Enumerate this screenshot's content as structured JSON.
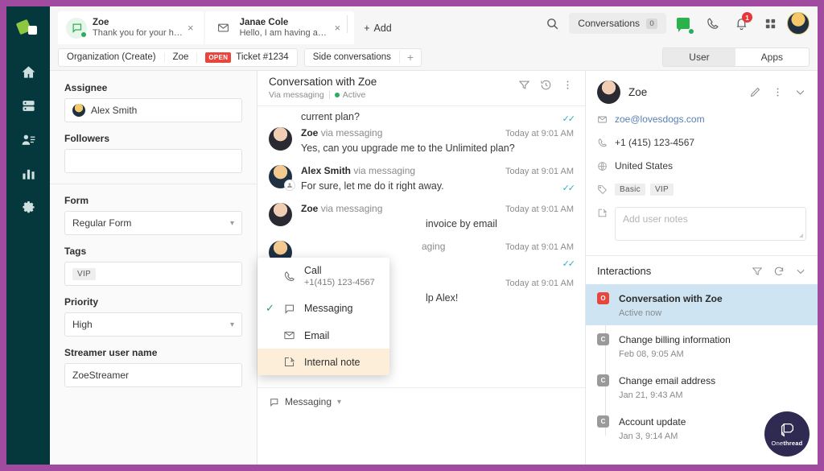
{
  "brand": {
    "accent_purple": "#a04ba0",
    "rail_bg": "#04383c",
    "logo_green": "#8dc63f"
  },
  "rail": {
    "logo_name": "app-logo",
    "items": [
      {
        "name": "home-icon",
        "label": "Home"
      },
      {
        "name": "inbox-icon",
        "label": "Inbox"
      },
      {
        "name": "contacts-icon",
        "label": "Contacts"
      },
      {
        "name": "analytics-icon",
        "label": "Analytics"
      },
      {
        "name": "gear-icon",
        "label": "Settings"
      }
    ]
  },
  "topbar": {
    "tabs": [
      {
        "title": "Zoe",
        "preview": "Thank you for your hel...",
        "icon": "chat-bubble-icon",
        "online": true,
        "close": "×"
      },
      {
        "title": "Janae Cole",
        "preview": "Hello, I am having an is...",
        "icon": "envelope-icon",
        "online": false,
        "close": "×"
      }
    ],
    "add_label": "Add",
    "add_plus": "+",
    "search_icon": "search-icon",
    "conversations_label": "Conversations",
    "conversations_count": "0",
    "chat_icon": "chat-icon",
    "phone_icon": "phone-icon",
    "bell_icon": "bell-icon",
    "bell_badge": "1",
    "apps_grid_icon": "grid-icon",
    "avatar": "user-avatar"
  },
  "breadcrumb": {
    "items": [
      {
        "label": "Organization (Create)"
      },
      {
        "label": "Zoe"
      },
      {
        "badge": "OPEN",
        "label": "Ticket #1234"
      }
    ],
    "side_conversations": "Side conversations",
    "plus": "+"
  },
  "segment": {
    "options": [
      "User",
      "Apps"
    ],
    "selected": "User"
  },
  "left_panel": {
    "fields": [
      {
        "label": "Assignee",
        "value": "Alex Smith",
        "type": "avatar-text"
      },
      {
        "label": "Followers",
        "value": "",
        "type": "text"
      },
      {
        "label": "Form",
        "value": "Regular Form",
        "type": "select"
      },
      {
        "label": "Tags",
        "value": "VIP",
        "type": "chip"
      },
      {
        "label": "Priority",
        "value": "High",
        "type": "select"
      },
      {
        "label": "Streamer user name",
        "value": "ZoeStreamer",
        "type": "text"
      }
    ]
  },
  "conversation": {
    "title": "Conversation with Zoe",
    "via": "Via messaging",
    "status": "Active",
    "actions": [
      "filter-icon",
      "history-icon",
      "more-vertical-icon"
    ],
    "continued_text": "current plan?",
    "messages": [
      {
        "author": "Zoe",
        "via": "via messaging",
        "time": "Today at 9:01 AM",
        "text": "Yes, can you upgrade me to the Unlimited plan?",
        "avatar": "zoe",
        "ticks": false,
        "agent": false
      },
      {
        "author": "Alex Smith",
        "via": "via messaging",
        "time": "Today at 9:01 AM",
        "text": "For sure, let me do it right away.",
        "avatar": "alex",
        "ticks": true,
        "agent": true
      },
      {
        "author": "Zoe",
        "via": "via messaging",
        "time": "Today at 9:01 AM",
        "text": "invoice by email",
        "avatar": "zoe",
        "ticks": false,
        "agent": false
      },
      {
        "author": "",
        "via": "aging",
        "time": "Today at 9:01 AM",
        "text": "",
        "avatar": "alex",
        "ticks": true,
        "agent": true
      },
      {
        "author": "",
        "via": "",
        "time": "Today at 9:01 AM",
        "text": "lp Alex!",
        "avatar": "zoe",
        "ticks": false,
        "agent": false
      }
    ],
    "composer_mode": "Messaging",
    "composer_caret": "⌄"
  },
  "channel_dropdown": {
    "items": [
      {
        "label": "Call",
        "sub": "+1(415) 123-4567",
        "icon": "phone-icon",
        "checked": false,
        "highlight": false
      },
      {
        "label": "Messaging",
        "sub": "",
        "icon": "chat-bubble-icon",
        "checked": true,
        "highlight": false
      },
      {
        "label": "Email",
        "sub": "",
        "icon": "envelope-icon",
        "checked": false,
        "highlight": false
      },
      {
        "label": "Internal note",
        "sub": "",
        "icon": "note-edit-icon",
        "checked": false,
        "highlight": true
      }
    ],
    "check_glyph": "✓"
  },
  "user_panel": {
    "name": "Zoe",
    "actions": [
      "pencil-icon",
      "more-vertical-icon",
      "chevron-down-icon"
    ],
    "email": "zoe@lovesdogs.com",
    "phone": "+1 (415) 123-4567",
    "country": "United States",
    "tags": [
      "Basic",
      "VIP"
    ],
    "notes_placeholder": "Add user notes"
  },
  "interactions": {
    "title": "Interactions",
    "actions": [
      "filter-icon",
      "refresh-icon",
      "chevron-down-icon"
    ],
    "items": [
      {
        "badge": "O",
        "title": "Conversation with Zoe",
        "sub": "Active now",
        "active": true
      },
      {
        "badge": "C",
        "title": "Change billing information",
        "sub": "Feb 08, 9:05 AM",
        "active": false
      },
      {
        "badge": "C",
        "title": "Change email address",
        "sub": "Jan 21, 9:43 AM",
        "active": false
      },
      {
        "badge": "C",
        "title": "Account update",
        "sub": "Jan 3, 9:14 AM",
        "active": false
      }
    ]
  },
  "watermark": {
    "name_pre": "One",
    "name_post": "thread"
  }
}
